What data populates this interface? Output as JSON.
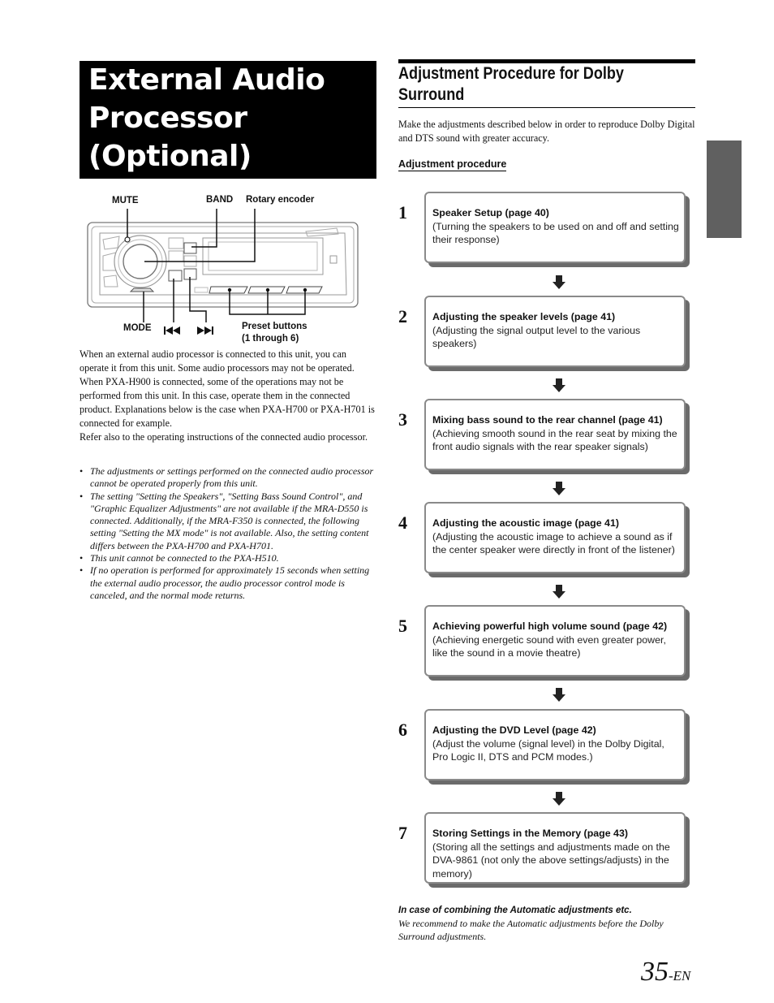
{
  "left": {
    "title_lines": [
      "External Audio",
      "Processor",
      "(Optional)"
    ],
    "diagram": {
      "labels": {
        "mute": "MUTE",
        "band": "BAND",
        "rotary_encoder": "Rotary encoder",
        "mode": "MODE",
        "preset_line1": "Preset buttons",
        "preset_line2": "(1 through 6)"
      },
      "icons": [
        "previous-track-icon",
        "next-track-icon"
      ]
    },
    "intro_paragraphs": [
      "When an external audio processor is connected to this unit, you can operate it from this unit. Some audio processors may not be operated. When PXA-H900 is connected, some of the operations may not be performed from this unit. In this case, operate them in the connected product. Explanations below is the case when PXA-H700 or PXA-H701 is connected for example.",
      "Refer also to the operating instructions of the connected audio processor."
    ],
    "notes": [
      "The adjustments or settings performed on the connected audio processor cannot be operated properly from this unit.",
      "The setting \"Setting the Speakers\", \"Setting Bass Sound Control\", and \"Graphic Equalizer Adjustments\" are not available if the MRA-D550 is connected. Additionally, if the MRA-F350 is connected, the following setting \"Setting the MX mode\" is not available. Also, the setting content differs between the PXA-H700 and PXA-H701.",
      "This unit cannot be connected to the PXA-H510.",
      "If no operation is performed for approximately 15 seconds when setting the external audio processor, the audio processor control mode is canceled, and the normal mode returns."
    ],
    "bullet_char": "•"
  },
  "right": {
    "section_title_lines": [
      "Adjustment Procedure for Dolby",
      "Surround"
    ],
    "lead": "Make the adjustments described below in order to reproduce Dolby Digital and DTS sound with greater accuracy.",
    "subhead": "Adjustment procedure",
    "steps": [
      {
        "num": "1",
        "title": "Speaker Setup (page 40)",
        "desc": "(Turning the speakers to be used on and off and setting their response)"
      },
      {
        "num": "2",
        "title": "Adjusting the speaker levels (page 41)",
        "desc": "(Adjusting the signal output level to the various speakers)"
      },
      {
        "num": "3",
        "title": "Mixing bass sound to the rear channel (page 41)",
        "desc": "(Achieving smooth sound in the rear seat by mixing the front audio signals with the rear speaker signals)"
      },
      {
        "num": "4",
        "title": "Adjusting the acoustic image (page 41)",
        "desc": "(Adjusting the acoustic image to achieve a sound as if the center speaker were directly in front of the listener)"
      },
      {
        "num": "5",
        "title": "Achieving powerful high volume sound (page 42)",
        "desc": "(Achieving energetic sound with even greater power, like the sound in a movie theatre)"
      },
      {
        "num": "6",
        "title": "Adjusting the DVD Level (page 42)",
        "desc": "(Adjust the volume (signal level) in the Dolby Digital, Pro Logic II, DTS and PCM modes.)"
      },
      {
        "num": "7",
        "title": "Storing Settings in the Memory (page 43)",
        "desc": "(Storing all the settings and adjustments made on the DVA-9861 (not only the above settings/adjusts) in the memory)"
      }
    ],
    "footnote_head": "In case of combining the Automatic adjustments etc.",
    "footnote_body": "We recommend to make the Automatic adjustments before the Dolby Surround adjustments."
  },
  "footer": {
    "page_number": "35",
    "page_suffix": "-EN"
  },
  "colors": {
    "side_tab": "#606060",
    "box_border": "#8a8a8a",
    "box_shadow": "#6b6b6b"
  }
}
